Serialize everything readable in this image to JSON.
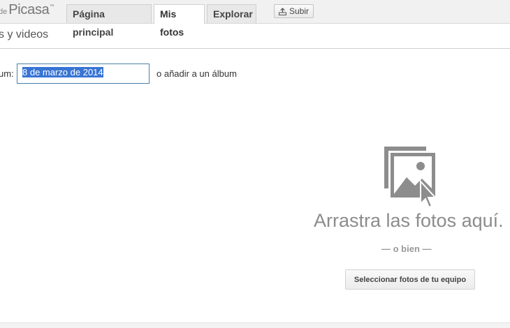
{
  "header": {
    "logo_prefix": "de",
    "logo_name": "Picasa",
    "logo_tm": "™",
    "tabs": [
      {
        "label": "Página principal"
      },
      {
        "label": "Mis fotos"
      },
      {
        "label": "Explorar"
      }
    ],
    "upload_label": "Subir"
  },
  "section": {
    "title": "s y videos"
  },
  "album": {
    "label": "um:",
    "value": "8 de marzo de 2014",
    "add_to_album": "o añadir a un álbum"
  },
  "dropzone": {
    "icon": "photo-cursor-icon",
    "text": "Arrastra las fotos aquí.",
    "or_text": "— o bien —",
    "select_button": "Seleccionar fotos de tu equipo"
  }
}
